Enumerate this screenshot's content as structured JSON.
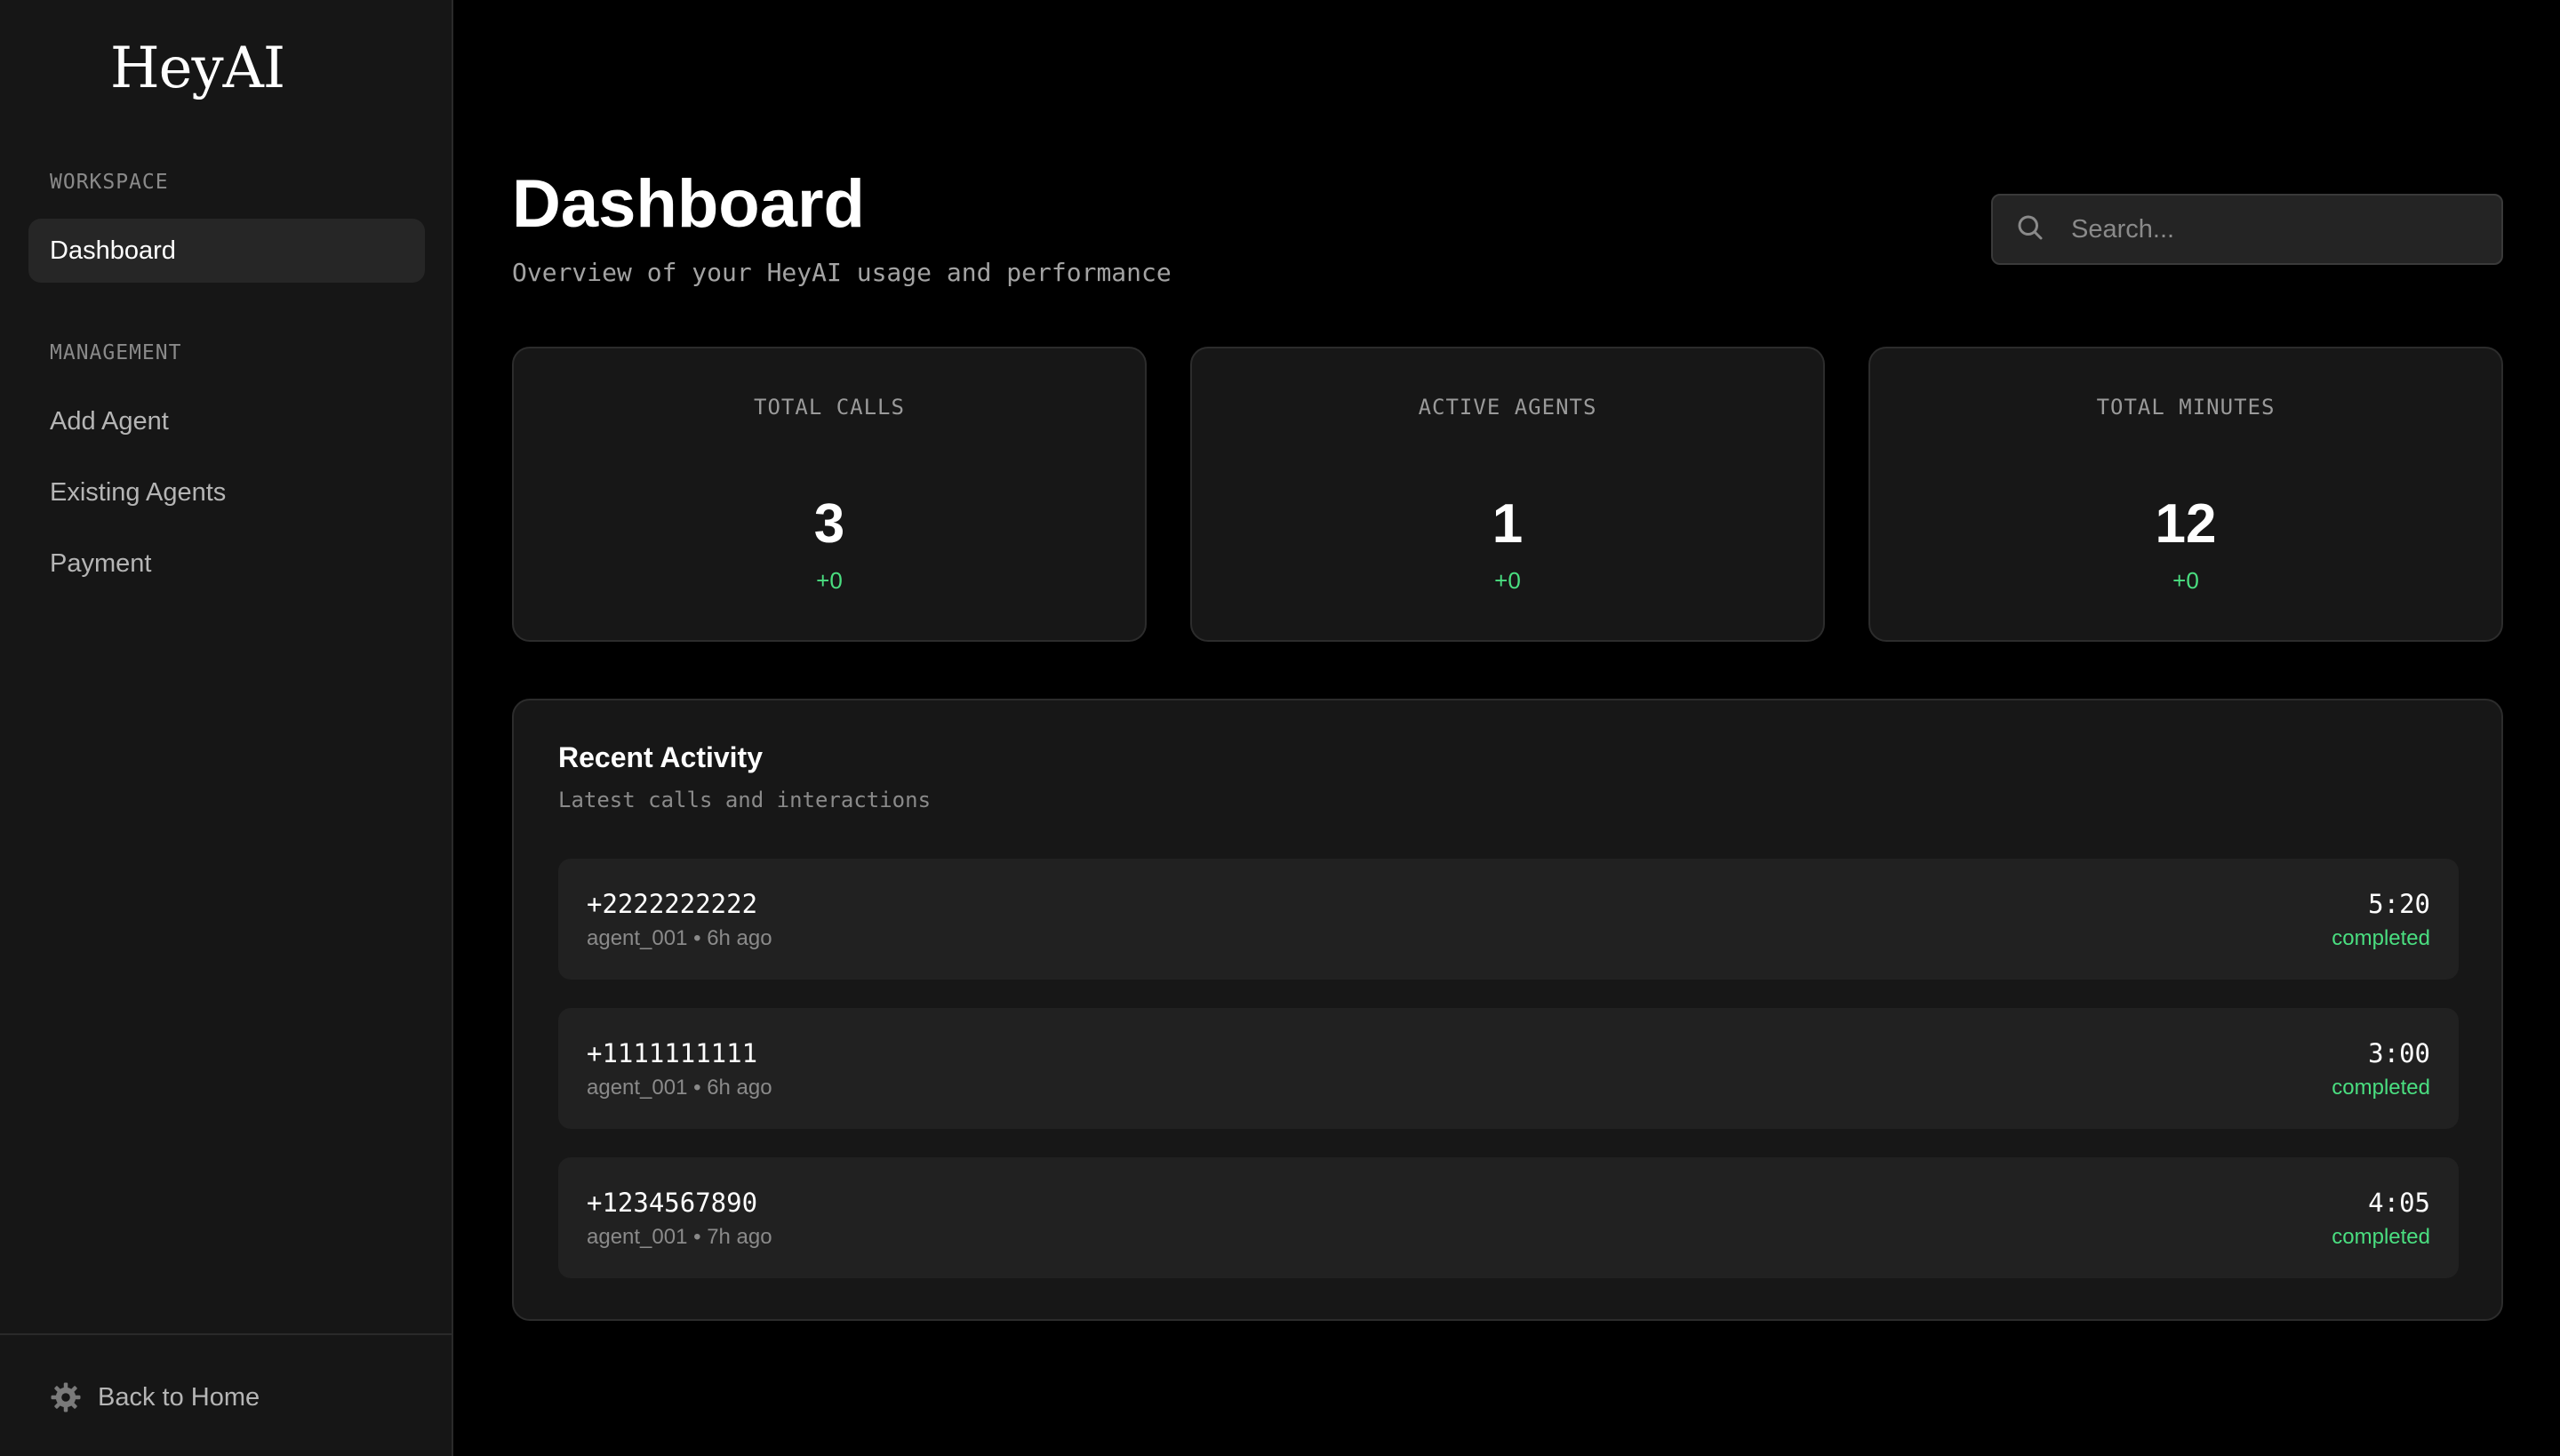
{
  "app": {
    "logo": "HeyAI"
  },
  "sidebar": {
    "workspace_label": "WORKSPACE",
    "workspace_items": [
      {
        "label": "Dashboard",
        "active": true
      }
    ],
    "management_label": "MANAGEMENT",
    "management_items": [
      {
        "label": "Add Agent"
      },
      {
        "label": "Existing Agents"
      },
      {
        "label": "Payment"
      }
    ],
    "footer": {
      "label": "Back to Home",
      "icon": "gear-icon"
    }
  },
  "header": {
    "title": "Dashboard",
    "subtitle": "Overview of your HeyAI usage and performance",
    "search_placeholder": "Search...",
    "search_icon": "search-icon"
  },
  "stats": [
    {
      "label": "TOTAL CALLS",
      "value": "3",
      "delta": "+0"
    },
    {
      "label": "ACTIVE AGENTS",
      "value": "1",
      "delta": "+0"
    },
    {
      "label": "TOTAL MINUTES",
      "value": "12",
      "delta": "+0"
    }
  ],
  "activity": {
    "title": "Recent Activity",
    "subtitle": "Latest calls and interactions",
    "rows": [
      {
        "phone": "+2222222222",
        "meta": "agent_001 • 6h ago",
        "duration": "5:20",
        "status": "completed"
      },
      {
        "phone": "+1111111111",
        "meta": "agent_001 • 6h ago",
        "duration": "3:00",
        "status": "completed"
      },
      {
        "phone": "+1234567890",
        "meta": "agent_001 • 7h ago",
        "duration": "4:05",
        "status": "completed"
      }
    ]
  },
  "colors": {
    "background": "#000000",
    "sidebar": "#161616",
    "card": "#171717",
    "row": "#212121",
    "positive": "#4ade80"
  }
}
